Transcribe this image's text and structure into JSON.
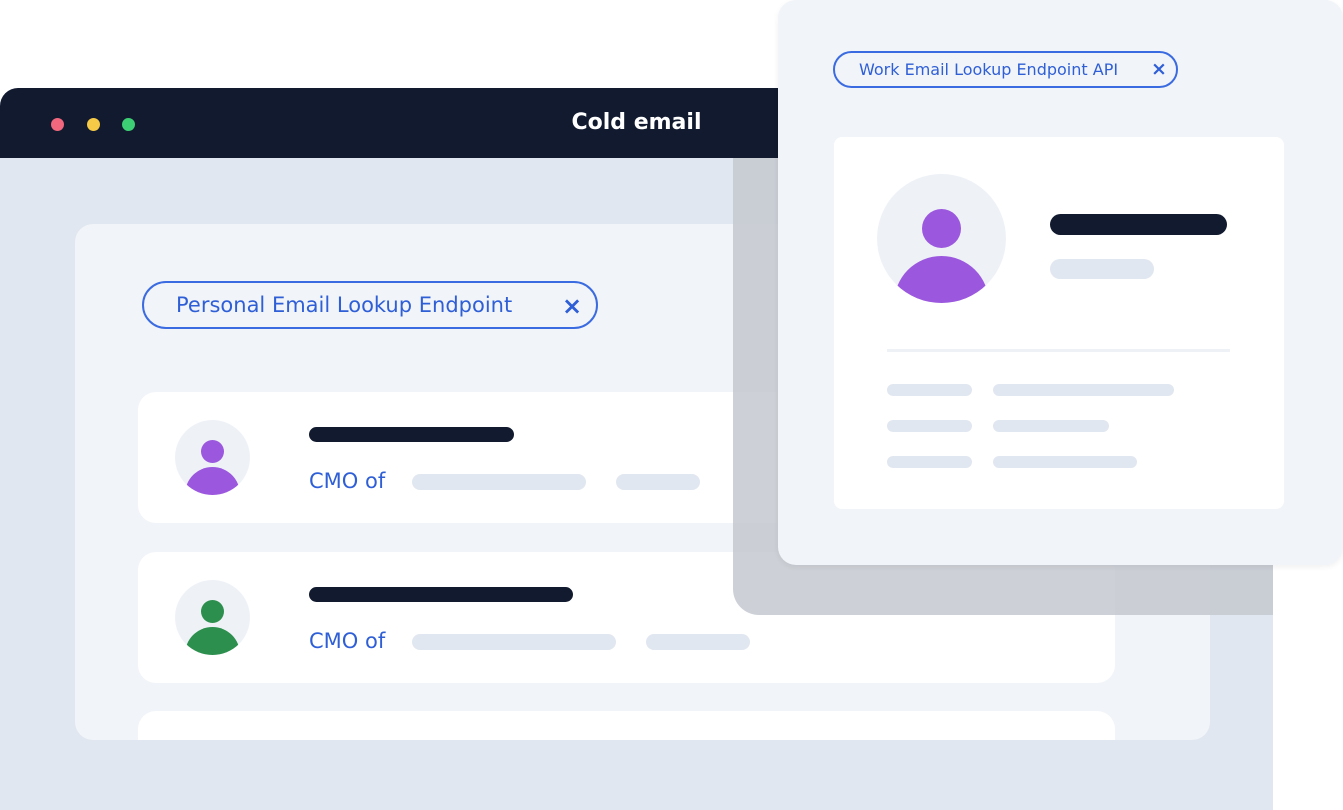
{
  "window": {
    "title": "Cold email",
    "traffic_lights": [
      "#f2677d",
      "#f6c946",
      "#3ccf73"
    ]
  },
  "main": {
    "filter_chip": {
      "label": "Personal Email Lookup Endpoint",
      "close_glyph": "×",
      "icon": "close-icon"
    },
    "results": [
      {
        "role_prefix": "CMO of",
        "avatar_color": "#9b57de",
        "avatar_icon": "user-icon"
      },
      {
        "role_prefix": "CMO of",
        "avatar_color": "#2c8f4d",
        "avatar_icon": "user-icon"
      }
    ]
  },
  "popup": {
    "filter_chip": {
      "label": "Work Email Lookup Endpoint API",
      "close_glyph": "×",
      "icon": "close-icon"
    },
    "profile": {
      "avatar_color": "#9b57de",
      "avatar_icon": "user-icon"
    }
  }
}
